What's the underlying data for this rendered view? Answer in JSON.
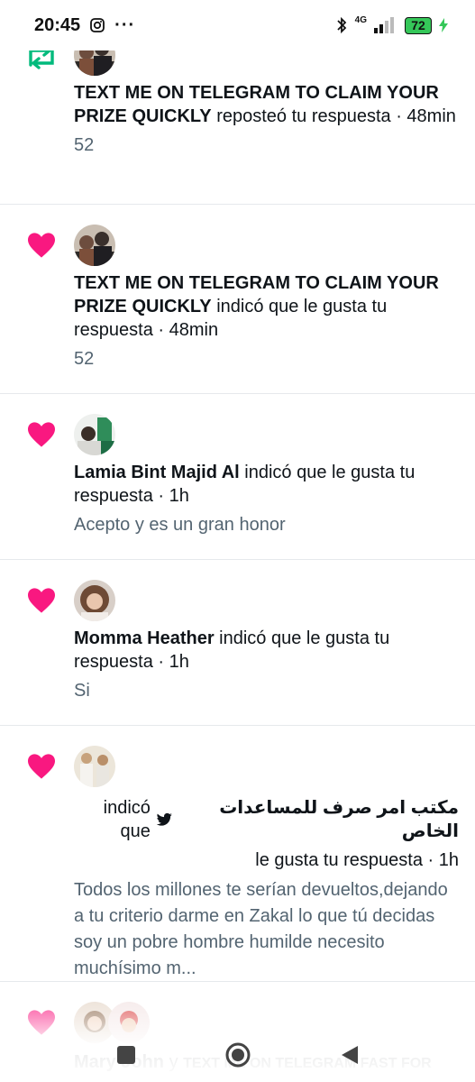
{
  "status_bar": {
    "time": "20:45",
    "network": "4G",
    "battery": "72",
    "icons": [
      "instagram-icon",
      "more-dots-icon",
      "bluetooth-icon",
      "signal-icon",
      "battery-icon",
      "charging-icon"
    ]
  },
  "notifications": [
    {
      "action_icon": "repost-icon",
      "name": "TEXT ME ON TELEGRAM TO CLAIM YOUR PRIZE QUICKLY",
      "action": "reposteó tu respuesta · 48min",
      "detail": "52"
    },
    {
      "action_icon": "heart-icon",
      "name": "TEXT ME ON TELEGRAM TO CLAIM YOUR PRIZE QUICKLY",
      "action": "indicó que le gusta tu respuesta · 48min",
      "detail": "52"
    },
    {
      "action_icon": "heart-icon",
      "name": "Lamia Bint Majid Al",
      "action": "indicó que le gusta tu respuesta · 1h",
      "detail": "Acepto y es un gran honor"
    },
    {
      "action_icon": "heart-icon",
      "name": "Momma Heather",
      "action": "indicó que le gusta tu respuesta · 1h",
      "detail": "Si"
    },
    {
      "action_icon": "heart-icon",
      "name": "مكتب امر صرف للمساعدات الخاص",
      "action_part1": "indicó que",
      "action_part2": "le gusta tu respuesta · 1h",
      "detail": "Todos los millones te serían devueltos,dejando a tu criterio darme en Zakal lo que tú decidas soy un pobre hombre humilde necesito muchísimo m..."
    },
    {
      "action_icon": "heart-icon",
      "name": "Mary John",
      "connector": "y",
      "name2": "TEXT ME ON TELEGRAM FAST FOR"
    }
  ],
  "colors": {
    "heart": "#f91880",
    "repost": "#00ba7c",
    "secondary_text": "#536471",
    "divider": "#e6e9ec"
  },
  "nav": [
    "recents-button",
    "home-button",
    "back-button"
  ]
}
